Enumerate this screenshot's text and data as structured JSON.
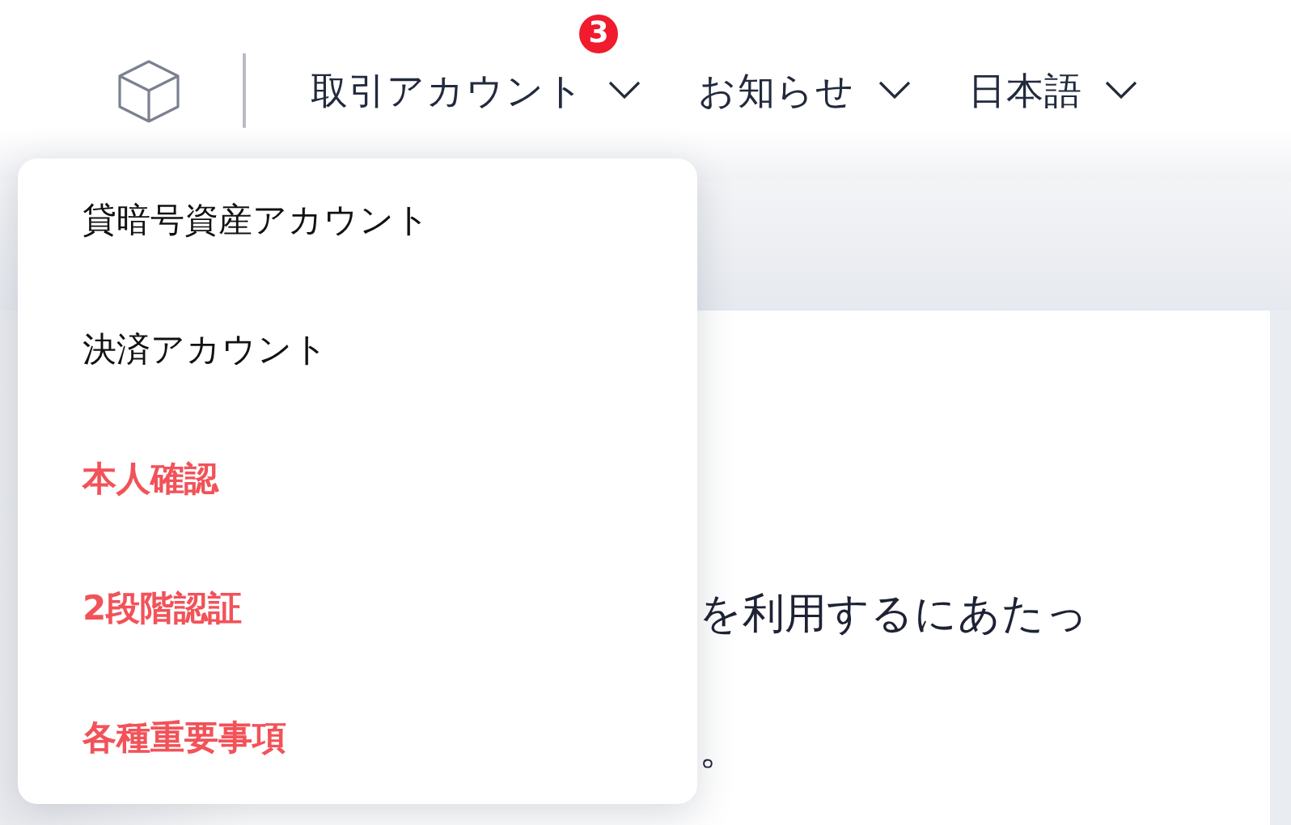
{
  "nav": {
    "items": [
      {
        "label": "取引アカウント",
        "badge": "3"
      },
      {
        "label": "お知らせ"
      },
      {
        "label": "日本語"
      }
    ]
  },
  "dropdown": {
    "items": [
      {
        "label": "貸暗号資産アカウント",
        "kind": "normal"
      },
      {
        "label": "決済アカウント",
        "kind": "normal"
      },
      {
        "label": "本人確認",
        "kind": "alert"
      },
      {
        "label": "2段階認証",
        "kind": "alert"
      },
      {
        "label": "各種重要事項",
        "kind": "alert"
      }
    ]
  },
  "content": {
    "lines": [
      "を利用するにあたっ",
      "。"
    ]
  }
}
